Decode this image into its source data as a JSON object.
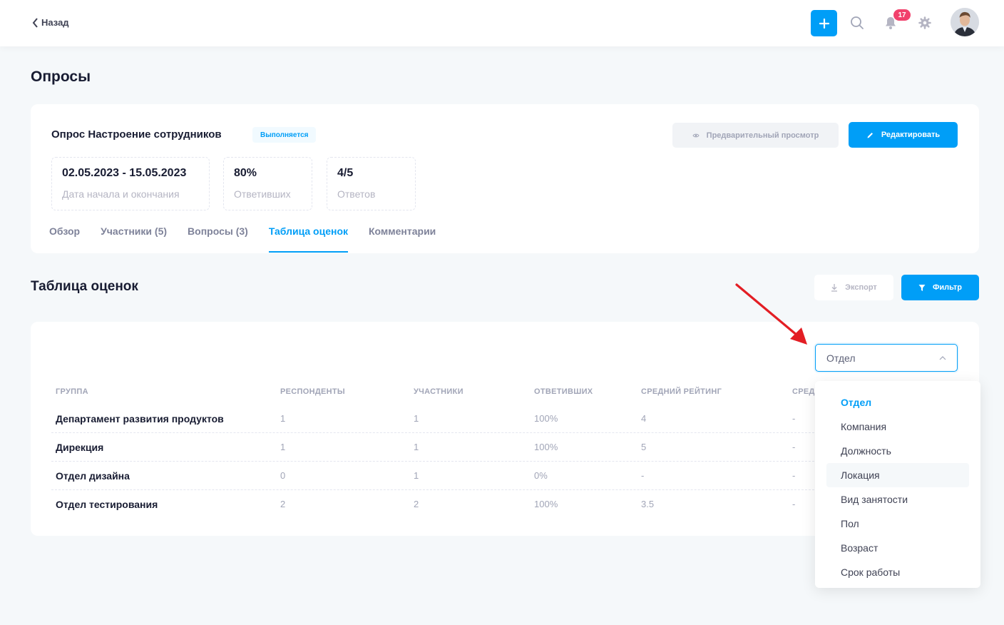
{
  "header": {
    "back_label": "Назад",
    "notifications_count": "17"
  },
  "page": {
    "title": "Опросы"
  },
  "survey": {
    "title": "Опрос Настроение сотрудников",
    "status": "Выполняется",
    "preview_label": "Предварительный просмотр",
    "edit_label": "Редактировать",
    "stats": [
      {
        "value": "02.05.2023 - 15.05.2023",
        "label": "Дата начала и окончания"
      },
      {
        "value": "80%",
        "label": "Ответивших"
      },
      {
        "value": "4/5",
        "label": "Ответов"
      }
    ],
    "tabs": [
      "Обзор",
      "Участники (5)",
      "Вопросы (3)",
      "Таблица оценок",
      "Комментарии"
    ],
    "active_tab": "Таблица оценок"
  },
  "ratings": {
    "title": "Таблица оценок",
    "export_label": "Экспорт",
    "filter_label": "Фильтр",
    "columns": [
      "ГРУППА",
      "РЕСПОНДЕНТЫ",
      "УЧАСТНИКИ",
      "ОТВЕТИВШИХ",
      "СРЕДНИЙ РЕЙТИНГ",
      "СРЕД"
    ],
    "rows": [
      {
        "group": "Департамент развития продуктов",
        "respondents": "1",
        "participants": "1",
        "answered": "100%",
        "avg_rating": "4",
        "extra": "-"
      },
      {
        "group": "Дирекция",
        "respondents": "1",
        "participants": "1",
        "answered": "100%",
        "avg_rating": "5",
        "extra": "-"
      },
      {
        "group": "Отдел дизайна",
        "respondents": "0",
        "participants": "1",
        "answered": "0%",
        "avg_rating": "-",
        "extra": "-"
      },
      {
        "group": "Отдел тестирования",
        "respondents": "2",
        "participants": "2",
        "answered": "100%",
        "avg_rating": "3.5",
        "extra": "-"
      }
    ]
  },
  "group_select": {
    "value": "Отдел",
    "options": [
      "Отдел",
      "Компания",
      "Должность",
      "Локация",
      "Вид занятости",
      "Пол",
      "Возраст",
      "Срок работы"
    ]
  },
  "colors": {
    "primary": "#009ef7",
    "danger": "#f1416c",
    "annotation_arrow": "#e31e24"
  }
}
